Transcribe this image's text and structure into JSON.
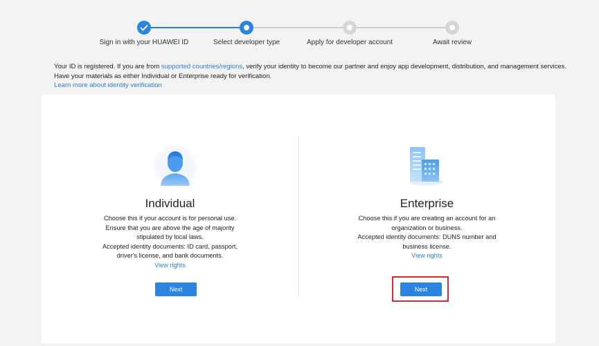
{
  "steps": [
    {
      "label": "Sign in with your HUAWEI ID",
      "state": "done"
    },
    {
      "label": "Select developer type",
      "state": "active"
    },
    {
      "label": "Apply for developer account",
      "state": "todo"
    },
    {
      "label": "Await review",
      "state": "todo"
    }
  ],
  "info": {
    "line1_prefix": "Your ID is registered. If you are from ",
    "line1_link": "supported countries/regions",
    "line1_suffix": ", verify your identity to become our partner and enjoy app development, distribution, and management services.",
    "line2": "Have your materials as either Individual or Enterprise ready for verification.",
    "learn_more": "Learn more about identity verification"
  },
  "individual": {
    "title": "Individual",
    "desc": [
      "Choose this if your account is for personal use.",
      "Ensure that you are above the age of majority",
      "stipulated by local laws.",
      "Accepted identity documents: ID card, passport,",
      "driver's license, and bank documents."
    ],
    "view_rights": "View rights",
    "next": "Next",
    "icon": "person-icon"
  },
  "enterprise": {
    "title": "Enterprise",
    "desc": [
      "Choose this if you are creating an account for an",
      "organization or business.",
      "Accepted identity documents: DUNS number and",
      "business license."
    ],
    "view_rights": "View rights",
    "next": "Next",
    "icon": "building-icon"
  },
  "colors": {
    "accent": "#2a84e0",
    "link": "#2a7fd4",
    "highlight": "#d9252b"
  }
}
